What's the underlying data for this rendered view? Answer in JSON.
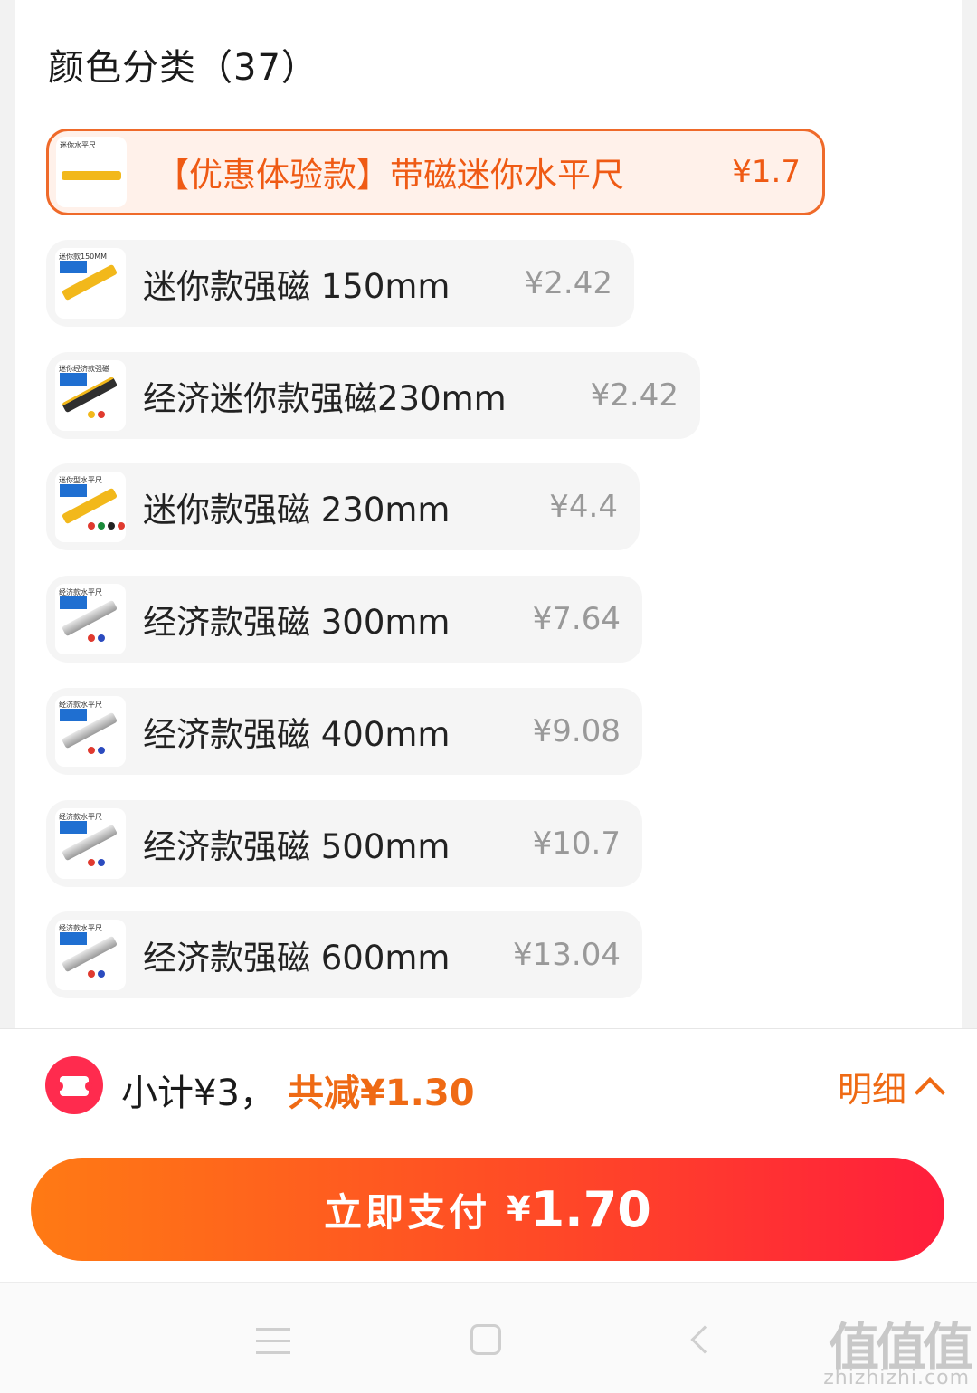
{
  "section": {
    "title": "颜色分类（37）"
  },
  "options": [
    {
      "label": "【优惠体验款】带磁迷你水平尺",
      "price": "¥1.7",
      "selected": true,
      "thumb_caption": "迷你水平尺"
    },
    {
      "label": "迷你款强磁 150mm",
      "price": "¥2.42",
      "selected": false,
      "thumb_caption": "迷你款150MM"
    },
    {
      "label": "经济迷你款强磁230mm",
      "price": "¥2.42",
      "selected": false,
      "thumb_caption": "迷你经济款强磁"
    },
    {
      "label": "迷你款强磁 230mm",
      "price": "¥4.4",
      "selected": false,
      "thumb_caption": "迷你型水平尺"
    },
    {
      "label": "经济款强磁 300mm",
      "price": "¥7.64",
      "selected": false,
      "thumb_caption": "经济款水平尺"
    },
    {
      "label": "经济款强磁 400mm",
      "price": "¥9.08",
      "selected": false,
      "thumb_caption": "经济款水平尺"
    },
    {
      "label": "经济款强磁 500mm",
      "price": "¥10.7",
      "selected": false,
      "thumb_caption": "经济款水平尺"
    },
    {
      "label": "经济款强磁 600mm",
      "price": "¥13.04",
      "selected": false,
      "thumb_caption": "经济款水平尺"
    }
  ],
  "summary": {
    "subtotal": "小计¥3，",
    "discount": "共减¥1.30",
    "detail_label": "明细"
  },
  "pay_button": {
    "label": "立即支付",
    "currency": "¥",
    "amount": "1.70"
  },
  "watermark": {
    "text": "值值值",
    "sub": "zhizhizhi.com"
  },
  "colors": {
    "accent": "#ef6a14",
    "selected_border": "#ef6a2a",
    "pay_gradient_start": "#ff7a14",
    "pay_gradient_end": "#ff1e3c",
    "coupon_red": "#ff2b4e"
  },
  "icons": {
    "coupon": "coupon-ticket-icon",
    "detail_toggle": "chevron-up-icon",
    "nav_menu": "menu-icon",
    "nav_home": "home-square-icon",
    "nav_back": "back-arrow-icon"
  }
}
